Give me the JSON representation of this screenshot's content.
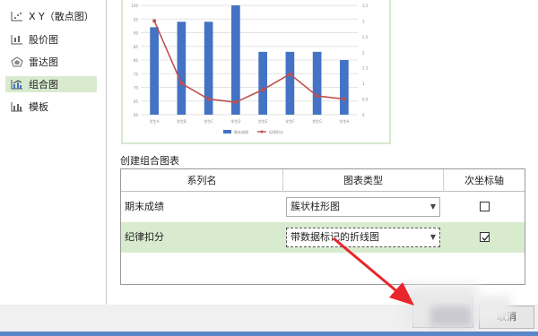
{
  "sidebar": {
    "items": [
      {
        "label": "X Y（散点图）",
        "icon": "scatter-chart-icon"
      },
      {
        "label": "股价图",
        "icon": "stock-chart-icon"
      },
      {
        "label": "雷达图",
        "icon": "radar-chart-icon"
      },
      {
        "label": "组合图",
        "icon": "combo-chart-icon",
        "selected": true
      },
      {
        "label": "模板",
        "icon": "template-chart-icon"
      }
    ]
  },
  "preview_chart": {
    "chart_data": {
      "type": "bar",
      "categories": [
        "学生A",
        "学生B",
        "学生C",
        "学生D",
        "学生E",
        "学生F",
        "学生G",
        "学生H"
      ],
      "series": [
        {
          "name": "期末成绩",
          "type": "bar",
          "axis": "primary",
          "values": [
            92,
            94,
            94,
            100,
            83,
            83,
            83,
            80
          ]
        },
        {
          "name": "纪律扣分",
          "type": "line",
          "axis": "secondary",
          "values": [
            3.0,
            1.0,
            0.5,
            0.4,
            0.8,
            1.3,
            0.6,
            0.5
          ]
        }
      ],
      "ylim": [
        60,
        100
      ],
      "yticks": [
        60,
        65,
        70,
        75,
        80,
        85,
        90,
        95,
        100
      ],
      "y2lim": [
        0,
        3.5
      ],
      "y2ticks": [
        0,
        0.5,
        1,
        1.5,
        2,
        2.5,
        3,
        3.5
      ],
      "bar_color": "#4472c4",
      "line_color": "#c0504d",
      "legend_position": "bottom"
    }
  },
  "combo": {
    "title": "创建组合图表",
    "headers": {
      "series": "系列名",
      "chart_type": "图表类型",
      "secondary_axis": "次坐标轴"
    },
    "rows": [
      {
        "name": "期末成绩",
        "chart_type": "簇状柱形图",
        "secondary": false
      },
      {
        "name": "纪律扣分",
        "chart_type": "带数据标记的折线图",
        "secondary": true,
        "selected": true
      }
    ]
  },
  "buttons": {
    "cancel": "取消"
  },
  "colors": {
    "selection": "#d8ebcf",
    "arrow": "#e8262b",
    "taskbar": "#5a86c8"
  }
}
